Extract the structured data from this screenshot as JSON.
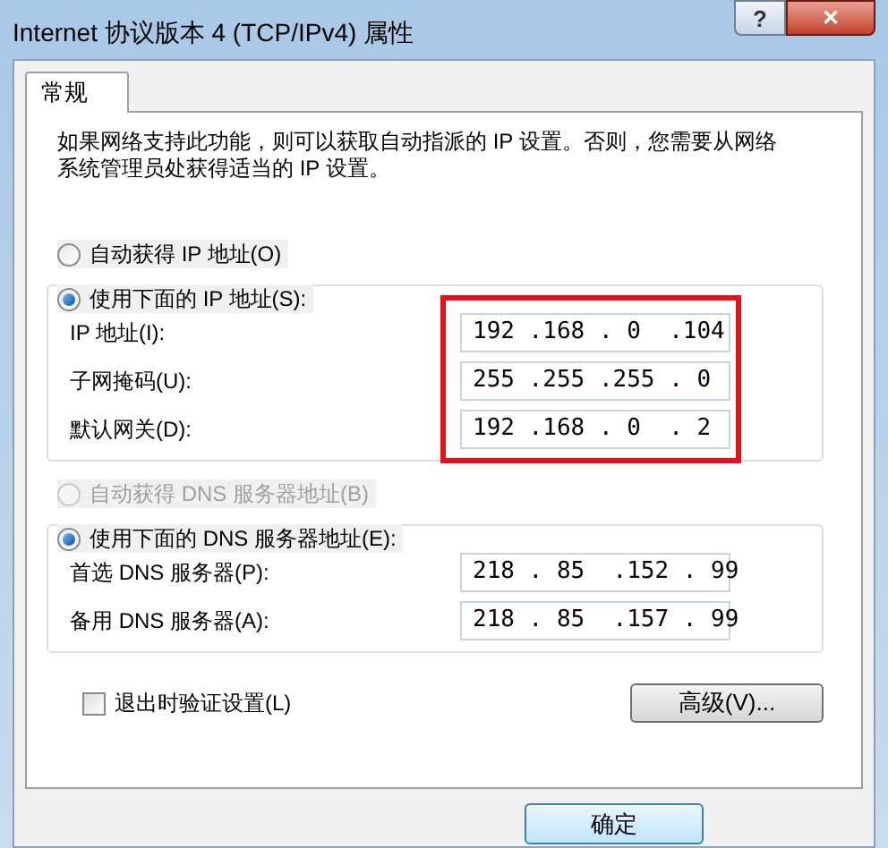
{
  "window": {
    "title": "Internet 协议版本 4 (TCP/IPv4) 属性",
    "help_button": "?",
    "close_button": "✕"
  },
  "tabs": [
    {
      "label": "常规",
      "selected": true
    }
  ],
  "description": "如果网络支持此功能，则可以获取自动指派的 IP 设置。否则，您需要从网络系统管理员处获得适当的 IP 设置。",
  "ip_mode": [
    {
      "label": "自动获得 IP 地址(O)",
      "selected": false,
      "disabled": false
    },
    {
      "label": "使用下面的 IP 地址(S):",
      "selected": true,
      "disabled": false
    }
  ],
  "ip_fields": [
    {
      "label": "IP 地址(I):",
      "value": "192 .168 . 0  .104"
    },
    {
      "label": "子网掩码(U):",
      "value": "255 .255 .255 . 0"
    },
    {
      "label": "默认网关(D):",
      "value": "192 .168 . 0  . 2"
    }
  ],
  "dns_mode": [
    {
      "label": "自动获得 DNS 服务器地址(B)",
      "selected": false,
      "disabled": true
    },
    {
      "label": "使用下面的 DNS 服务器地址(E):",
      "selected": true,
      "disabled": false
    }
  ],
  "dns_fields": [
    {
      "label": "首选 DNS 服务器(P):",
      "value": "218 . 85  .152 . 99"
    },
    {
      "label": "备用 DNS 服务器(A):",
      "value": "218 . 85  .157 . 99"
    }
  ],
  "validate_on_exit": {
    "label": "退出时验证设置(L)",
    "checked": false
  },
  "advanced_button": "高级(V)...",
  "ok_button": "确定"
}
